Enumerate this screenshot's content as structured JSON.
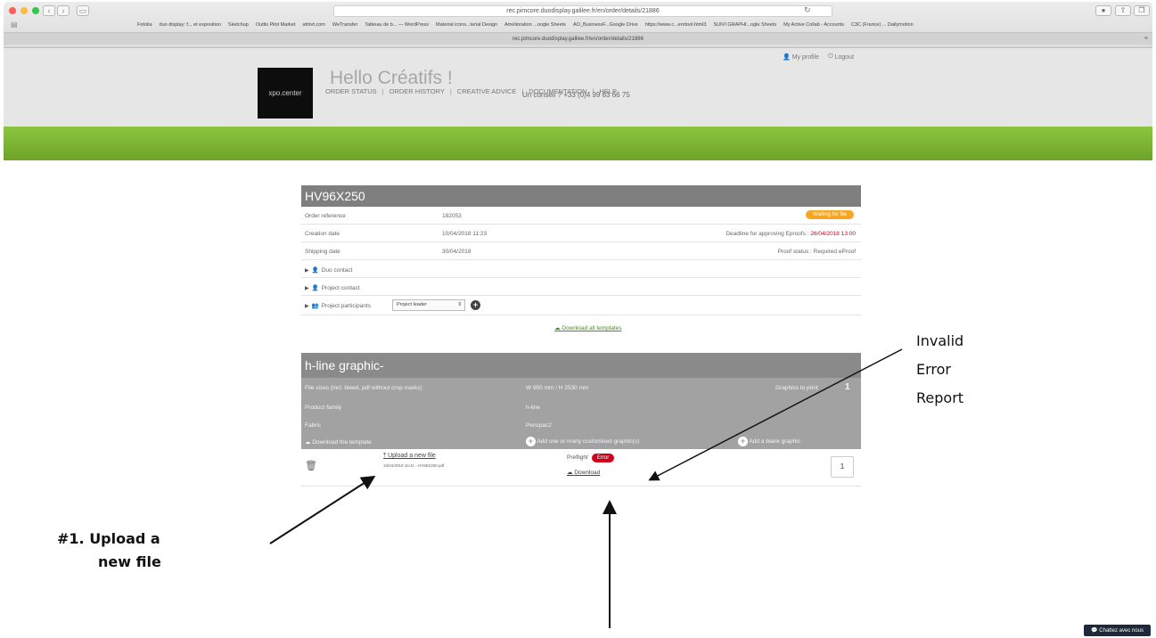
{
  "browser": {
    "url": "rec.pimcore.duodisplay.galilee.fr/en/order/details/21886",
    "tab_title": "rec.pimcore.duodisplay.galilee.fr/en/order/details/21886",
    "bookmarks": [
      "Fotolia",
      "duo display: f... et exposition",
      "Sketchup",
      "Outils Pilot Market",
      "attrivt.com",
      "WeTransfer",
      "Tableau de b... — WordPress",
      "Material icons...terial Design",
      "Amélioration ...oogle Sheets",
      "AO_BusinessF...Google Drive",
      "https://www.c...enrtool.html3",
      "SUIVI GRAPHI...ogle Sheets",
      "My Active Collab - Accounts",
      "C3C (France) ... Dailymotion"
    ]
  },
  "header": {
    "my_profile": "My profile",
    "logout": "Logout",
    "logo_text": "xpo.center",
    "greeting": "Hello Créatifs !",
    "advice_phone": "Un conseil ? +33 (0)4 99 63 66 75",
    "nav": [
      "ORDER STATUS",
      "ORDER HISTORY",
      "CREATIVE ADVICE",
      "DOCUMENTATION",
      "HELP"
    ]
  },
  "order": {
    "title": "HV96X250",
    "reference_label": "Order reference",
    "reference_value": "182053",
    "status_badge": "Waiting for file",
    "creation_label": "Creation date",
    "creation_value": "10/04/2018 11:23",
    "deadline_label": "Deadline for approving Eproofs :",
    "deadline_value": "26/04/2018 13:00",
    "shipping_label": "Shipping date",
    "shipping_value": "30/04/2018",
    "proof_status": "Proof status : Required eProof",
    "duo_contact": "Duo contact",
    "project_contact": "Project contact",
    "project_participants": "Project participants",
    "participant_select": "Project leader",
    "download_all": "Download all templates"
  },
  "graphic": {
    "title": "h-line graphic-",
    "file_sizes_label": "File sizes (incl. bleed, pdf without crop marks)",
    "file_sizes_value": "W 950 mm / H 2530 mm",
    "graphics_label": "Graphics to print",
    "graphics_count": "1",
    "product_family_label": "Product family",
    "product_family_value": "h-line",
    "fabric_label": "Fabric",
    "fabric_value": "Pencpac2",
    "download_template": "Download the template",
    "add_custom": "Add one or many customised graphic(s)",
    "add_blank": "Add a blank graphic",
    "upload_link": "Upload a new file",
    "upload_meta": "16/04/2018 16:41 - HV96X250.pdf",
    "preflight_label": "Preflight",
    "preflight_status": "Error",
    "download": "Download",
    "quantity": "1"
  },
  "annotations": {
    "upload_note_line1": "#1. Upload a",
    "upload_note_line2": "new file",
    "invalid_note_line1": "Invalid",
    "invalid_note_line2": "Error",
    "invalid_note_line3": "Report"
  },
  "chat": {
    "label": "Chattez avec nous"
  },
  "colors": {
    "green": "#7cb733",
    "error": "#d0021b",
    "waiting": "#f5a623",
    "panel_grey": "#7f7f7f"
  }
}
